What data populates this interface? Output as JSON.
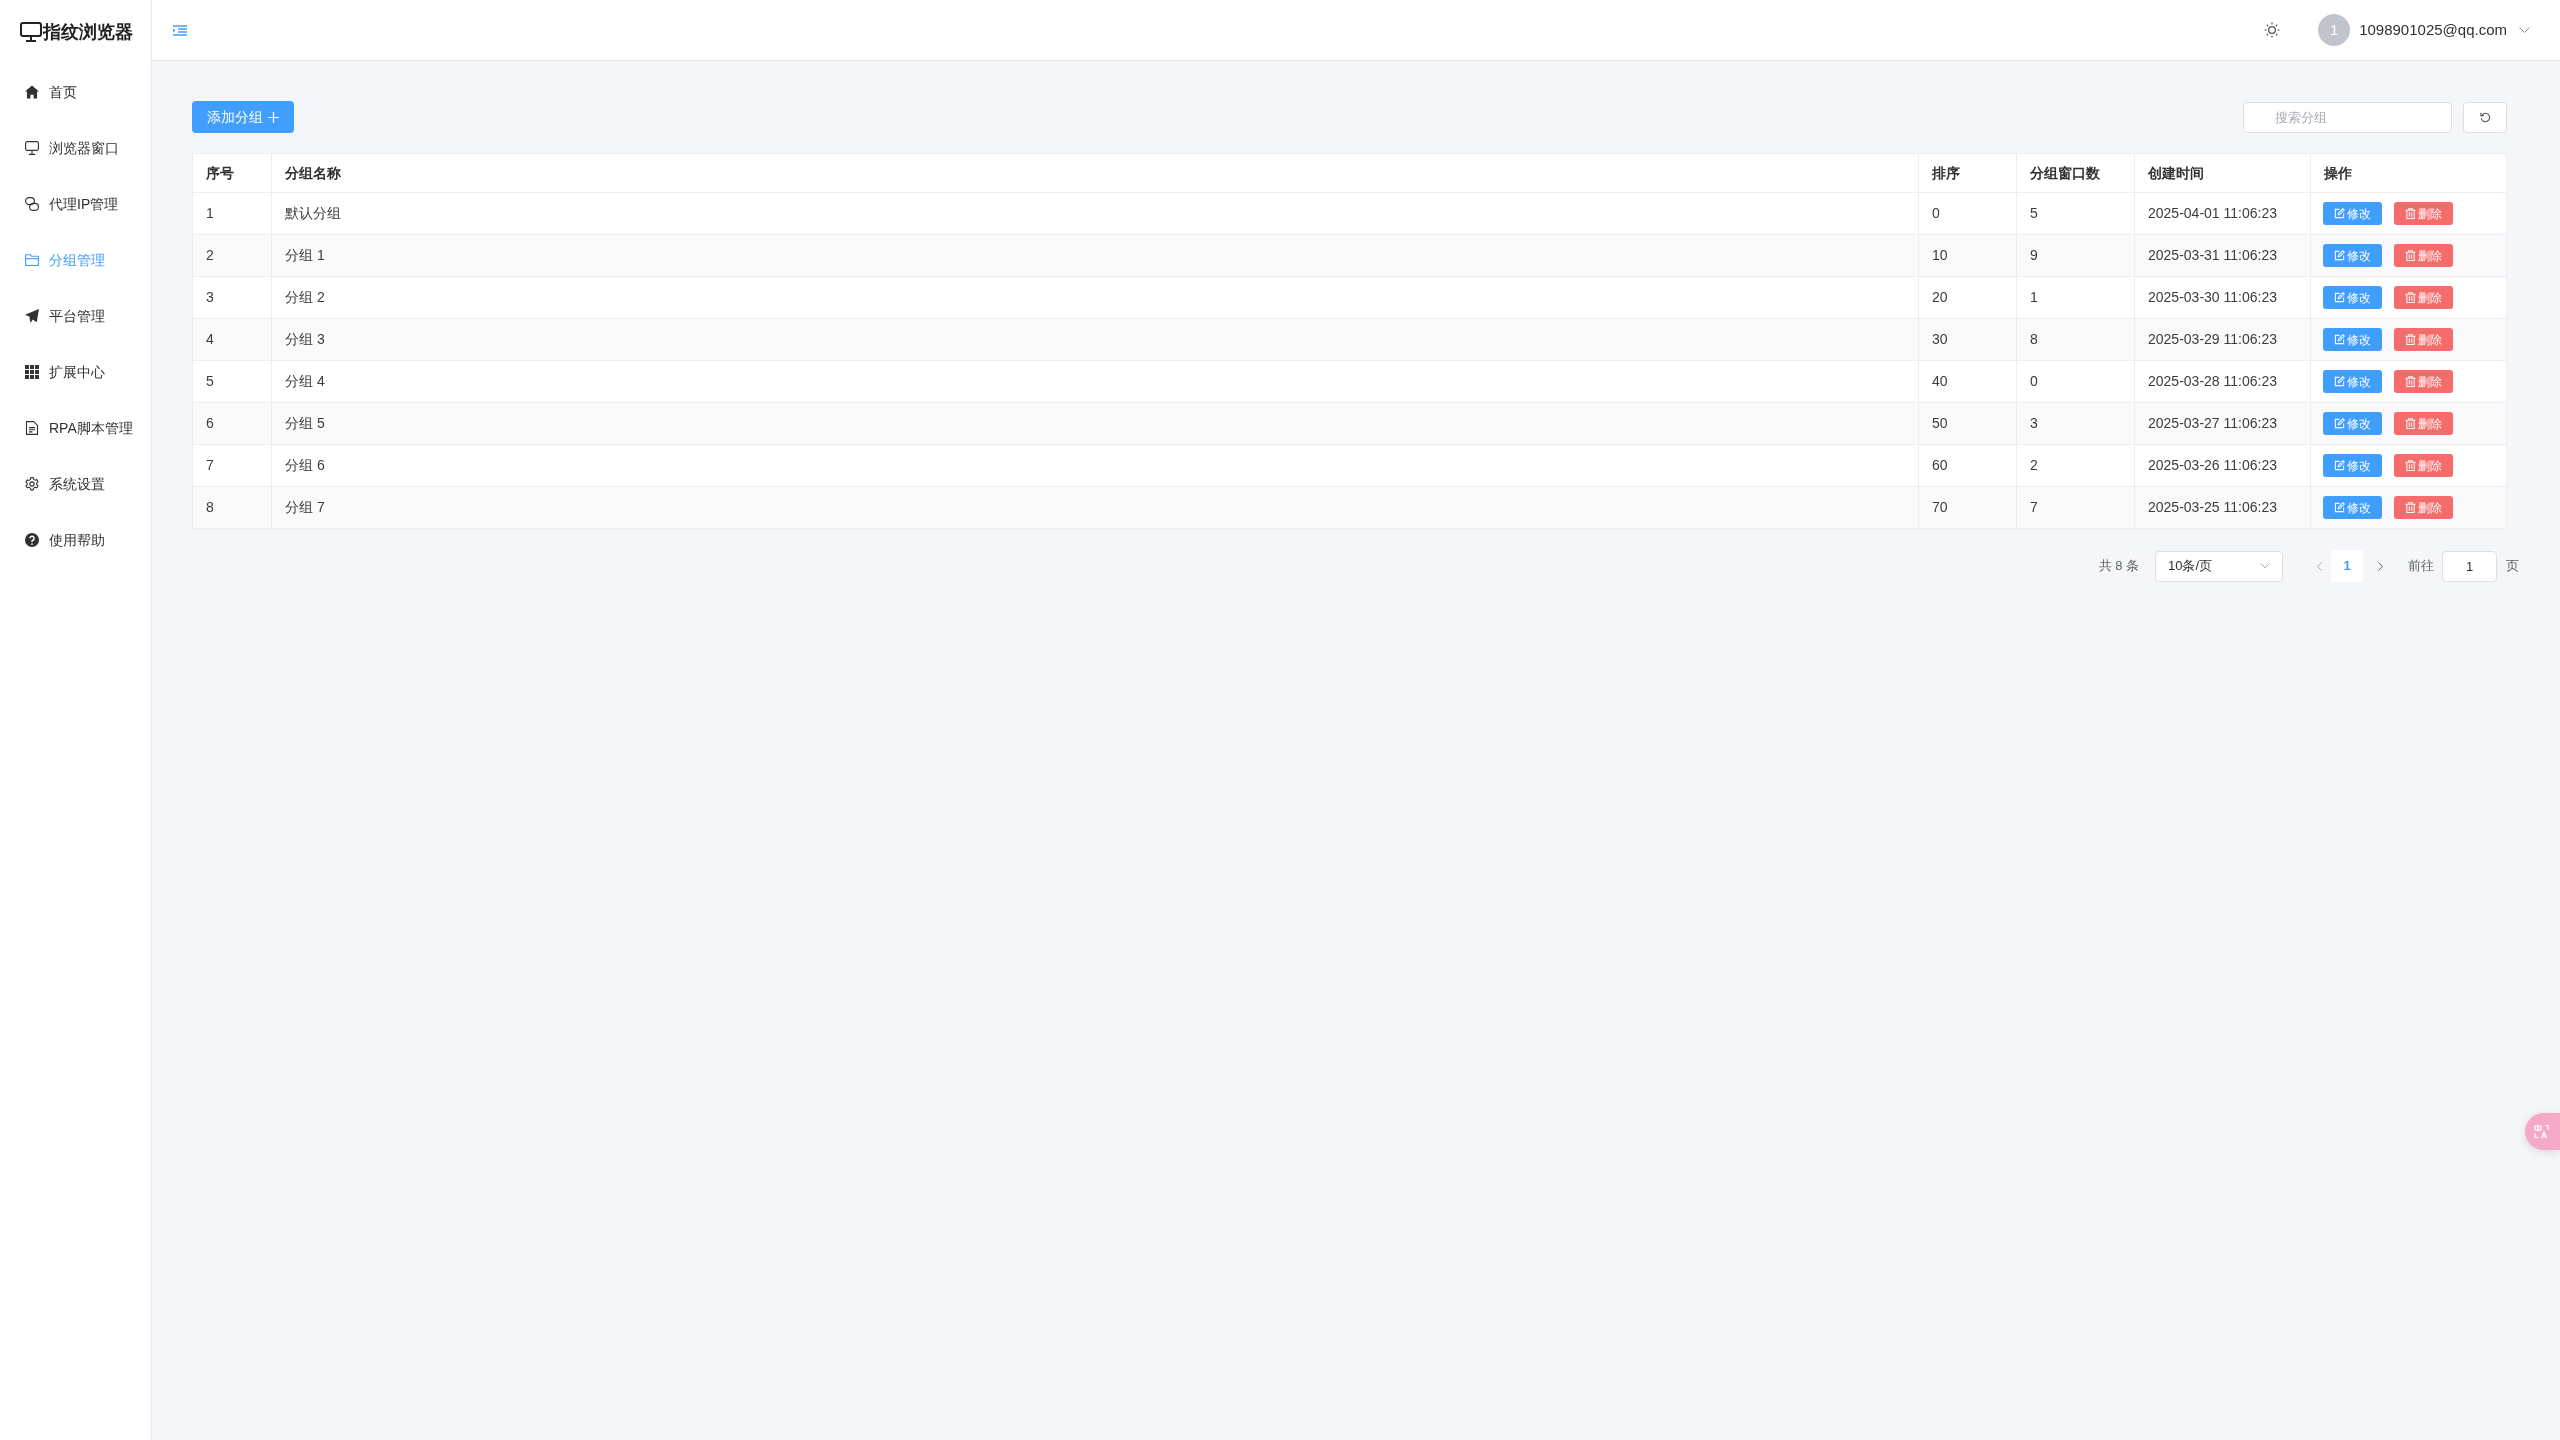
{
  "sidebar": {
    "logo": "指纹浏览器",
    "items": [
      {
        "label": "首页",
        "selected": false
      },
      {
        "label": "浏览器窗口",
        "selected": false
      },
      {
        "label": "代理IP管理",
        "selected": false
      },
      {
        "label": "分组管理",
        "selected": true
      },
      {
        "label": "平台管理",
        "selected": false
      },
      {
        "label": "扩展中心",
        "selected": false
      },
      {
        "label": "RPA脚本管理",
        "selected": false
      },
      {
        "label": "系统设置",
        "selected": false
      },
      {
        "label": "使用帮助",
        "selected": false
      }
    ]
  },
  "header": {
    "user": {
      "avatar": "1",
      "email": "1098901025@qq.com"
    }
  },
  "toolbar": {
    "add_button": "添加分组",
    "search": {
      "placeholder": "搜索分组"
    }
  },
  "table": {
    "columns": [
      "序号",
      "分组名称",
      "排序",
      "分组窗口数",
      "创建时间",
      "操作"
    ],
    "rows": [
      {
        "cells": [
          "1",
          "默认分组",
          "0",
          "5",
          "2025-04-01 11:06:23"
        ],
        "actions": [
          {
            "label": "修改",
            "kind": "edit"
          },
          {
            "label": "删除",
            "kind": "delete"
          }
        ]
      },
      {
        "cells": [
          "2",
          "分组 1",
          "10",
          "9",
          "2025-03-31 11:06:23"
        ],
        "actions": [
          {
            "label": "修改",
            "kind": "edit"
          },
          {
            "label": "删除",
            "kind": "delete"
          }
        ]
      },
      {
        "cells": [
          "3",
          "分组 2",
          "20",
          "1",
          "2025-03-30 11:06:23"
        ],
        "actions": [
          {
            "label": "修改",
            "kind": "edit"
          },
          {
            "label": "删除",
            "kind": "delete"
          }
        ]
      },
      {
        "cells": [
          "4",
          "分组 3",
          "30",
          "8",
          "2025-03-29 11:06:23"
        ],
        "actions": [
          {
            "label": "修改",
            "kind": "edit"
          },
          {
            "label": "删除",
            "kind": "delete"
          }
        ]
      },
      {
        "cells": [
          "5",
          "分组 4",
          "40",
          "0",
          "2025-03-28 11:06:23"
        ],
        "actions": [
          {
            "label": "修改",
            "kind": "edit"
          },
          {
            "label": "删除",
            "kind": "delete"
          }
        ]
      },
      {
        "cells": [
          "6",
          "分组 5",
          "50",
          "3",
          "2025-03-27 11:06:23"
        ],
        "actions": [
          {
            "label": "修改",
            "kind": "edit"
          },
          {
            "label": "删除",
            "kind": "delete"
          }
        ]
      },
      {
        "cells": [
          "7",
          "分组 6",
          "60",
          "2",
          "2025-03-26 11:06:23"
        ],
        "actions": [
          {
            "label": "修改",
            "kind": "edit"
          },
          {
            "label": "删除",
            "kind": "delete"
          }
        ]
      },
      {
        "cells": [
          "8",
          "分组 7",
          "70",
          "7",
          "2025-03-25 11:06:23"
        ],
        "actions": [
          {
            "label": "修改",
            "kind": "edit"
          },
          {
            "label": "删除",
            "kind": "delete"
          }
        ]
      }
    ]
  },
  "pagination": {
    "total": "共 8 条",
    "page_size": "10条/页",
    "pages": [
      {
        "label": "1",
        "selected": true
      }
    ],
    "jump": {
      "prefix": "前往",
      "value": "1",
      "suffix": "页"
    }
  }
}
